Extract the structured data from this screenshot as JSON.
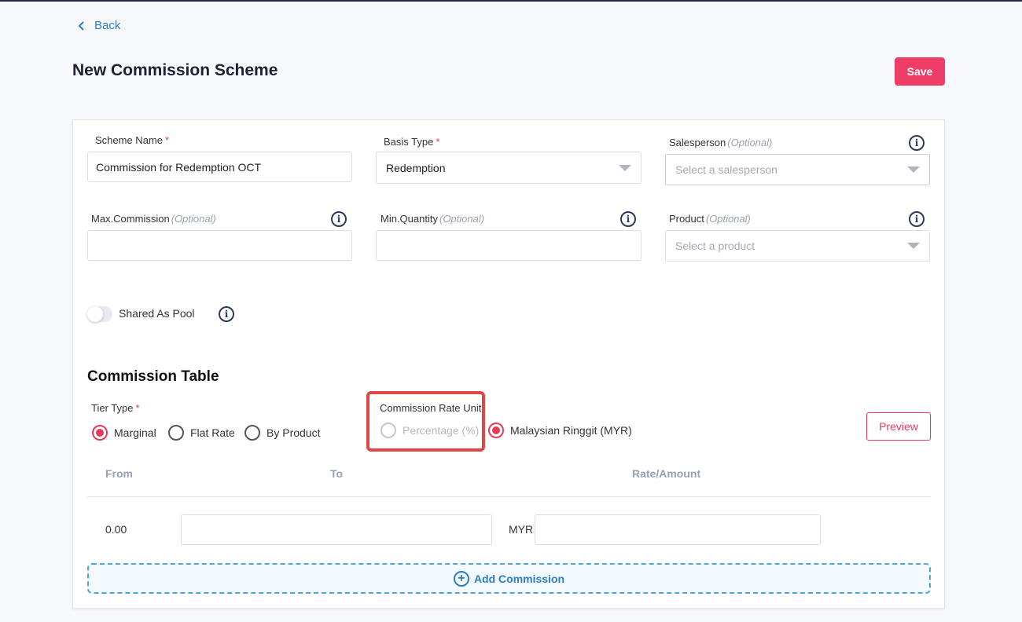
{
  "nav": {
    "back_label": "Back"
  },
  "header": {
    "title": "New Commission Scheme",
    "save_label": "Save"
  },
  "form": {
    "scheme_name": {
      "label": "Scheme Name",
      "required": "*",
      "value": "Commission for Redemption OCT"
    },
    "basis_type": {
      "label": "Basis Type",
      "required": "*",
      "value": "Redemption"
    },
    "salesperson": {
      "label": "Salesperson",
      "optional": "(Optional)",
      "placeholder": "Select a salesperson"
    },
    "max_commission": {
      "label": "Max.Commission",
      "optional": "(Optional)",
      "value": ""
    },
    "min_quantity": {
      "label": "Min.Quantity",
      "optional": "(Optional)",
      "value": ""
    },
    "product": {
      "label": "Product",
      "optional": "(Optional)",
      "placeholder": "Select a product"
    },
    "shared_pool": {
      "label": "Shared As Pool",
      "enabled": false
    }
  },
  "commission_table": {
    "title": "Commission Table",
    "tier_type": {
      "label": "Tier Type",
      "required": "*",
      "options": [
        "Marginal",
        "Flat Rate",
        "By Product"
      ],
      "selected": "Marginal"
    },
    "rate_unit": {
      "label": "Commission Rate Unit",
      "options": [
        "Percentage (%)",
        "Malaysian Ringgit (MYR)"
      ],
      "selected": "Malaysian Ringgit (MYR)"
    },
    "preview_label": "Preview",
    "columns": [
      "From",
      "To",
      "Rate/Amount"
    ],
    "rows": [
      {
        "from": "0.00",
        "to": "",
        "currency": "MYR",
        "rate": ""
      }
    ],
    "add_label": "Add Commission"
  },
  "colors": {
    "accent": "#ee3d66",
    "link": "#2a7fc4",
    "highlight": "#e04646"
  }
}
